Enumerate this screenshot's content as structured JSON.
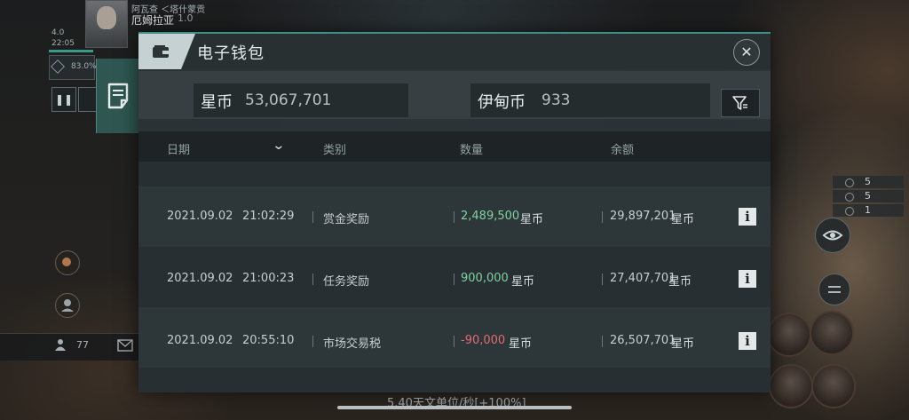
{
  "pilot": {
    "corp": "阿瓦查 ＜塔什蒙贡",
    "name": "厄姆拉亚",
    "security": "1.0",
    "time": "22:05",
    "cargo": "83.0%",
    "tag": "4.0"
  },
  "hud_left": {
    "pause_icon": "pause-icon",
    "people_count": "77"
  },
  "hud_right": {
    "stats": [
      "5",
      "5",
      "1"
    ]
  },
  "wallet": {
    "title": "电子钱包",
    "icon": "wallet-icon",
    "isk_label": "星币",
    "isk_value": "53,067,701",
    "plex_label": "伊甸币",
    "plex_value": "933",
    "columns": {
      "date": "日期",
      "category": "类别",
      "amount": "数量",
      "balance": "余额"
    },
    "unit": "星币",
    "transactions": [
      {
        "date": "2021.09.02",
        "time": "21:02:29",
        "category": "赏金奖励",
        "amount": "2,489,500",
        "balance": "29,897,201"
      },
      {
        "date": "2021.09.02",
        "time": "21:00:23",
        "category": "任务奖励",
        "amount": "900,000",
        "balance": "27,407,701"
      },
      {
        "date": "2021.09.02",
        "time": "20:55:10",
        "category": "市场交易税",
        "amount": "-90,000",
        "balance": "26,507,701"
      }
    ]
  },
  "status": {
    "speed": "5.40天文单位/秒[+100%]"
  },
  "colors": {
    "accent": "#3f8f86",
    "positive": "#7fd2a2",
    "negative": "#e06b75"
  }
}
